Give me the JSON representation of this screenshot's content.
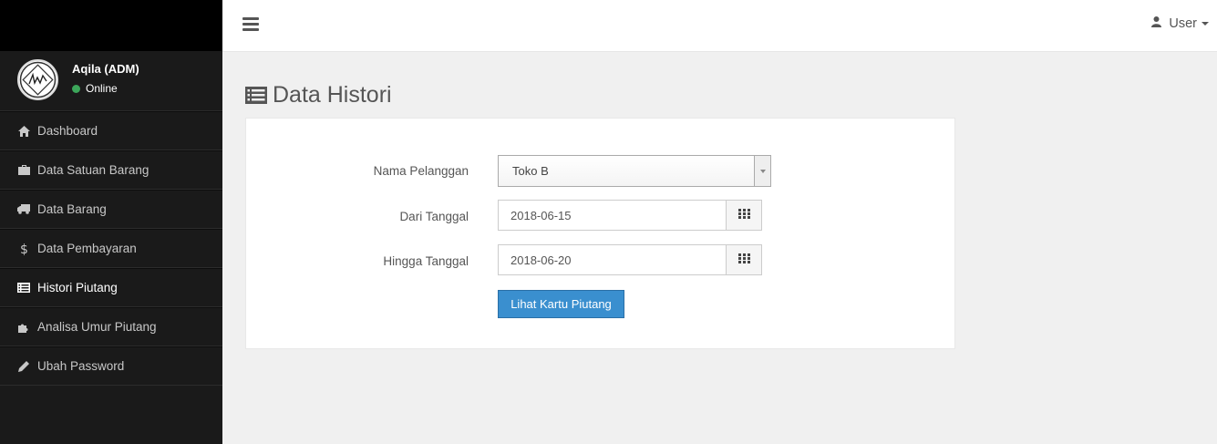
{
  "user_panel": {
    "name": "Aqila (ADM)",
    "status": "Online"
  },
  "sidebar": {
    "items": [
      {
        "label": "Dashboard",
        "icon": "home-icon"
      },
      {
        "label": "Data Satuan Barang",
        "icon": "briefcase-icon"
      },
      {
        "label": "Data Barang",
        "icon": "truck-icon"
      },
      {
        "label": "Data Pembayaran",
        "icon": "dollar-icon"
      },
      {
        "label": "Histori Piutang",
        "icon": "list-alt-icon",
        "active": true
      },
      {
        "label": "Analisa Umur Piutang",
        "icon": "puzzle-icon"
      },
      {
        "label": "Ubah Password",
        "icon": "pencil-icon"
      }
    ]
  },
  "topbar": {
    "user_label": "User"
  },
  "page": {
    "title": "Data Histori"
  },
  "form": {
    "customer_label": "Nama Pelanggan",
    "customer_value": "Toko B",
    "from_label": "Dari Tanggal",
    "from_value": "2018-06-15",
    "to_label": "Hingga Tanggal",
    "to_value": "2018-06-20",
    "submit_label": "Lihat Kartu Piutang"
  },
  "colors": {
    "sidebar_bg": "#1a1a1a",
    "primary": "#3a8fcf",
    "status_online": "#3ca65a"
  }
}
